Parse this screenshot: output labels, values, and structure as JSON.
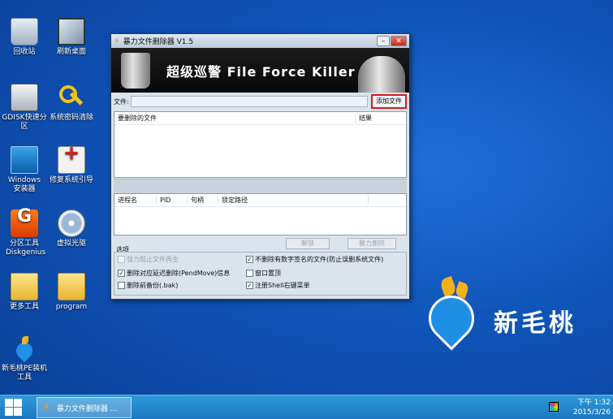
{
  "desktop": {
    "icons": [
      {
        "label": "回收站",
        "icon": "recycle-bin-icon"
      },
      {
        "label": "刷新桌面",
        "icon": "refresh-desktop-icon"
      },
      {
        "label": "GDISK快速分区",
        "icon": "gdisk-icon"
      },
      {
        "label": "系统密码清除",
        "icon": "key-icon"
      },
      {
        "label": "Windows安装器",
        "icon": "windows-installer-icon"
      },
      {
        "label": "修复系统引导",
        "icon": "repair-kit-icon"
      },
      {
        "label": "分区工具Diskgenius",
        "icon": "diskgenius-icon"
      },
      {
        "label": "虚拟光驱",
        "icon": "cd-icon"
      },
      {
        "label": "更多工具",
        "icon": "folder-icon"
      },
      {
        "label": "program",
        "icon": "folder-icon"
      },
      {
        "label": "新毛桃PE装机工具",
        "icon": "peach-icon"
      }
    ],
    "brand_text": "新毛桃"
  },
  "window": {
    "title": "暴力文件删除器 V1.5",
    "banner_title": "超级巡警 File Force Killer",
    "file_label": "文件:",
    "file_value": "",
    "add_file_button": "添加文件",
    "files_table": {
      "columns": [
        "要删除的文件",
        "结果"
      ],
      "rows": []
    },
    "process_table": {
      "columns": [
        "进程名",
        "PID",
        "句柄",
        "锁定路径"
      ],
      "rows": []
    },
    "unlock_button": "解锁",
    "force_delete_button": "暴力删除",
    "options_label": "选项",
    "options": [
      {
        "label": "强力阻止文件再生",
        "checked": false,
        "enabled": false
      },
      {
        "label": "不删除有数字签名的文件(防止误删系统文件)",
        "checked": true,
        "enabled": true
      },
      {
        "label": "删除对应延迟删除(PendMove)信息",
        "checked": true,
        "enabled": true
      },
      {
        "label": "窗口置顶",
        "checked": false,
        "enabled": true
      },
      {
        "label": "删除前备份(.bak)",
        "checked": false,
        "enabled": true
      },
      {
        "label": "注册Shell右键菜单",
        "checked": true,
        "enabled": true
      }
    ]
  },
  "taskbar": {
    "app_label": "暴力文件删除器 ...",
    "time": "下午 1:32",
    "date": "2015/3/26"
  },
  "colors": {
    "desktop_bg": "#0f54b8",
    "taskbar": "#1f84cb",
    "highlight_border": "#d81b1b"
  }
}
